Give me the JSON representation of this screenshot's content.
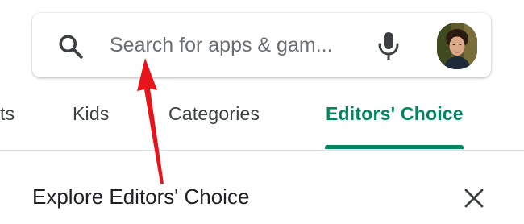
{
  "search": {
    "placeholder": "Search for apps & gam...",
    "search_icon": "search-icon",
    "mic_icon": "mic-icon",
    "avatar_icon": "user-avatar"
  },
  "tabs": [
    {
      "label": "ts",
      "active": false
    },
    {
      "label": "Kids",
      "active": false
    },
    {
      "label": "Categories",
      "active": false
    },
    {
      "label": "Editors' Choice",
      "active": true
    }
  ],
  "section": {
    "title": "Explore Editors' Choice",
    "close_icon": "close-icon"
  },
  "colors": {
    "accent": "#01875f",
    "annotation": "#e8141c",
    "text_primary": "#202124",
    "text_secondary": "#5f6368",
    "divider": "#dadce0"
  }
}
